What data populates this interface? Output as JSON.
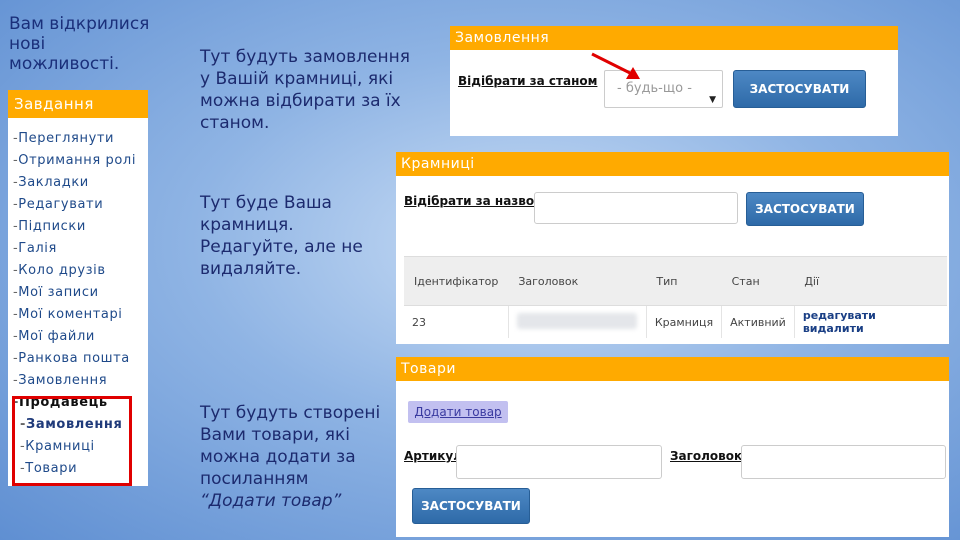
{
  "intro": {
    "line1": "Вам відкрилися",
    "line2": "нові",
    "line3": "можливості."
  },
  "notes": {
    "orders": [
      "Тут будуть замовлення",
      "у Вашій крамниці, які",
      "можна відбирати за їх",
      "станом."
    ],
    "stores": [
      "Тут буде Ваша",
      "крамниця.",
      "Редагуйте, але не",
      "видаляйте."
    ],
    "products": [
      "Тут будуть створені",
      "Вами товари, які",
      "можна додати за",
      "посиланням"
    ],
    "products_link": "“Додати товар”"
  },
  "sidebar": {
    "title": "Завдання",
    "items": [
      {
        "label": "Переглянути"
      },
      {
        "label": "Отримання ролі"
      },
      {
        "label": "Закладки"
      },
      {
        "label": "Редагувати"
      },
      {
        "label": "Підписки"
      },
      {
        "label": "Галія"
      },
      {
        "label": "Коло друзів"
      },
      {
        "label": "Мої записи"
      },
      {
        "label": "Мої коментарі"
      },
      {
        "label": "Мої файли"
      },
      {
        "label": "Ранкова пошта"
      },
      {
        "label": "Замовлення"
      }
    ],
    "seller": {
      "label": "Продавець",
      "items": [
        {
          "label": "Замовлення"
        },
        {
          "label": "Крамниці"
        },
        {
          "label": "Товари"
        }
      ]
    }
  },
  "orders_panel": {
    "title": "Замовлення",
    "filter_label": "Відібрати за станом",
    "select_value": "- будь-що -",
    "apply_label": "ЗАСТОСУВАТИ"
  },
  "stores_panel": {
    "title": "Крамниці",
    "filter_label": "Відібрати за назвою",
    "apply_label": "ЗАСТОСУВАТИ",
    "columns": [
      "Ідентифікатор",
      "Заголовок",
      "Тип",
      "Стан",
      "Дії"
    ],
    "row": {
      "id": "23",
      "type": "Крамниця",
      "state": "Активний",
      "edit": "редагувати",
      "delete": "видалити"
    }
  },
  "products_panel": {
    "title": "Товари",
    "add_link": "Додати товар",
    "sku_label": "Артикул",
    "title_label": "Заголовок",
    "apply_label": "ЗАСТОСУВАТИ"
  },
  "colors": {
    "header": "#ffaa00",
    "button": "#3a78b7",
    "highlight": "#e00000"
  }
}
